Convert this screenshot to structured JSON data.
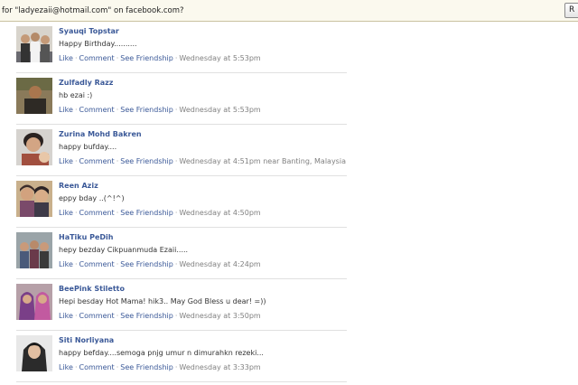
{
  "topbar": {
    "prompt": "for \"ladyezaii@hotmail.com\" on facebook.com?",
    "button_label": "R"
  },
  "actions": {
    "like": "Like",
    "comment": "Comment",
    "see_friendship": "See Friendship",
    "separator": "·"
  },
  "posts": [
    {
      "name": "Syauqi Topstar",
      "message": "Happy Birthday..........",
      "time": "Wednesday at 5:53pm"
    },
    {
      "name": "Zulfadly Razz",
      "message": "hb ezai :)",
      "time": "Wednesday at 5:53pm"
    },
    {
      "name": "Zurina Mohd Bakren",
      "message": "happy bufday....",
      "time": "Wednesday at 4:51pm near Banting, Malaysia"
    },
    {
      "name": "Reen Aziz",
      "message": "eppy bday ..(^!^)",
      "time": "Wednesday at 4:50pm"
    },
    {
      "name": "HaTiku PeDih",
      "message": "hepy bezday Cikpuanmuda Ezaii.....",
      "time": "Wednesday at 4:24pm"
    },
    {
      "name": "BeePink Stiletto",
      "message": "Hepi besday Hot Mama! hik3.. May God Bless u dear! =))",
      "time": "Wednesday at 3:50pm"
    },
    {
      "name": "Siti Norliyana",
      "message": "happy befday....semoga pnjg umur n dimurahkn rezeki...",
      "time": "Wednesday at 3:33pm"
    }
  ]
}
